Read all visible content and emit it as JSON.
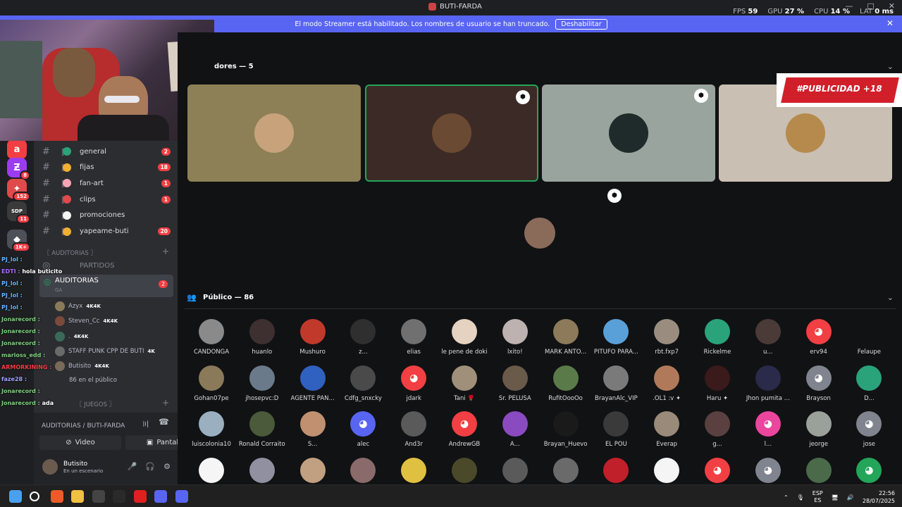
{
  "window": {
    "title": "BUTI-FARDA",
    "controls": [
      "—",
      "□",
      "✕"
    ]
  },
  "perf": {
    "fps_label": "FPS",
    "fps": "59",
    "gpu_label": "GPU",
    "gpu": "27 %",
    "cpu_label": "CPU",
    "cpu": "14 %",
    "lat_label": "LAT",
    "lat": "0 ms"
  },
  "banner": {
    "text": "El modo Streamer está habilitado. Los nombres de usuario se han truncado.",
    "button": "Deshabilitar"
  },
  "servers": [
    {
      "glyph": "a",
      "color": "#f23f43",
      "badge": ""
    },
    {
      "glyph": "Ƶ",
      "color": "#9b3cf1",
      "badge": "8"
    },
    {
      "glyph": "✦",
      "color": "#e04a4a",
      "badge": "152"
    },
    {
      "glyph": "SDP",
      "color": "#3a3a3a",
      "badge": "11"
    },
    {
      "glyph": "◆",
      "color": "#4e5058",
      "badge": "1K+"
    }
  ],
  "channels": [
    {
      "name": "general",
      "count": "2",
      "color": "#2aa37a"
    },
    {
      "name": "fijas",
      "count": "18",
      "color": "#f0b132"
    },
    {
      "name": "fan-art",
      "count": "1",
      "color": "#f7a5b5"
    },
    {
      "name": "clips",
      "count": "1",
      "color": "#e04a4a"
    },
    {
      "name": "promociones",
      "count": "",
      "color": "#f5f5f5"
    },
    {
      "name": "yapeame-buti",
      "count": "20",
      "color": "#f0b132"
    }
  ],
  "categories": {
    "auditorias": "〖 AUDITORIAS 〗",
    "juegos": "〖 JUEGOS 〗"
  },
  "partidos": "PARTIDOS",
  "stage_channel": {
    "name": "AUDITORIAS",
    "sub": "GA",
    "count": "2"
  },
  "stage_members": [
    {
      "name": "Azyx",
      "tag": "4K4K"
    },
    {
      "name": "Steven_Cc",
      "tag": "4K4K"
    },
    {
      "name": ".",
      "tag": "4K4K"
    },
    {
      "name": "STAFF PUNK CPP DE BUTI",
      "tag": "4K"
    },
    {
      "name": "Butisito",
      "tag": "4K4K"
    }
  ],
  "audience_count_label": "86 en el público",
  "chat": [
    {
      "user": "PJ_lol :",
      "msg": "",
      "color": "#6ab0ff"
    },
    {
      "user": "EDTI :",
      "msg": "hola buticito",
      "color": "#b06bff"
    },
    {
      "user": "PJ_lol :",
      "msg": "",
      "color": "#6ab0ff"
    },
    {
      "user": "PJ_lol :",
      "msg": "",
      "color": "#6ab0ff"
    },
    {
      "user": "PJ_lol :",
      "msg": "",
      "color": "#6ab0ff"
    },
    {
      "user": "Jonarecord :",
      "msg": "",
      "color": "#7ad37a"
    },
    {
      "user": "Jonarecord :",
      "msg": "",
      "color": "#7ad37a"
    },
    {
      "user": "Jonarecord :",
      "msg": "",
      "color": "#7ad37a"
    },
    {
      "user": "marioss_edd :",
      "msg": "",
      "color": "#7ad37a"
    },
    {
      "user": "ARMORKINING :",
      "msg": "",
      "color": "#f23f43"
    },
    {
      "user": "faze28 :",
      "msg": "",
      "color": "#a0a0ff"
    },
    {
      "user": "Jonarecord :",
      "msg": "",
      "color": "#7ad37a"
    },
    {
      "user": "Jonarecord :",
      "msg": "ada",
      "color": "#7ad37a"
    }
  ],
  "voice": {
    "location": "AUDITORIAS / BUTI-FARDA",
    "video": "Video",
    "screen": "Pantalla",
    "user": "Butisito",
    "user_status": "En un escenario"
  },
  "speakers_header": "dores — 5",
  "speakers": [
    {
      "color": "#8d8056",
      "avatar": "#c7a27a",
      "mod": false,
      "active": false
    },
    {
      "color": "#3c2a26",
      "avatar": "#6b4a33",
      "mod": true,
      "active": true
    },
    {
      "color": "#9aa49f",
      "avatar": "#1e2b2a",
      "mod": true,
      "active": false
    },
    {
      "color": "#c9bfb2",
      "avatar": "#b58a4c",
      "mod": false,
      "active": false
    }
  ],
  "host_avatar": "#8a6b5a",
  "promo": "#PUBLICIDAD +18",
  "audience_header": "Público — 86",
  "audience": [
    {
      "name": "CANDONGA",
      "color": "#8a8a8a"
    },
    {
      "name": "huanlo",
      "color": "#3e3030"
    },
    {
      "name": "Mushuro",
      "color": "#c0392b"
    },
    {
      "name": "z...",
      "color": "#2f2f2f"
    },
    {
      "name": "elias",
      "color": "#707070"
    },
    {
      "name": "le pene de doki",
      "color": "#e6d2c0"
    },
    {
      "name": "lxito!",
      "color": "#bdb2b0"
    },
    {
      "name": "MARK ANTO...",
      "color": "#8c7a5a"
    },
    {
      "name": "PITUFO PARA...",
      "color": "#5aa0d8"
    },
    {
      "name": "rbt.fxp7",
      "color": "#9a8d80"
    },
    {
      "name": "Rickelme",
      "color": "#2aa37a"
    },
    {
      "name": "u...",
      "color": "#4a3a38"
    },
    {
      "name": "erv94",
      "color": "#f23f43",
      "discord": true
    },
    {
      "name": "Felaupe",
      "color": "#111214"
    },
    {
      "name": "Gohan07pe",
      "color": "#8a7a5a"
    },
    {
      "name": "jhosepvc:D",
      "color": "#6a7a8a"
    },
    {
      "name": "AGENTE PAN...",
      "color": "#3060c0"
    },
    {
      "name": "Cdfg_snxcky",
      "color": "#4a4a4a"
    },
    {
      "name": "jdark",
      "color": "#f23f43",
      "discord": true
    },
    {
      "name": "Tani 🌹",
      "color": "#a0907a"
    },
    {
      "name": "Sr. PELUSA",
      "color": "#6a5a4a"
    },
    {
      "name": "RufitOooOo",
      "color": "#5a7a4a"
    },
    {
      "name": "BrayanAlc_VIP",
      "color": "#7a7a7a"
    },
    {
      "name": ".OL1 :v ✦",
      "color": "#b07a5a"
    },
    {
      "name": "Haru ✦",
      "color": "#3a1a1a"
    },
    {
      "name": "Jhon pumita ...",
      "color": "#2a2a4a"
    },
    {
      "name": "Brayson",
      "color": "#80848e",
      "discord": true
    },
    {
      "name": "D...",
      "color": "#2aa37a"
    },
    {
      "name": "luiscolonia10",
      "color": "#9ab0c0"
    },
    {
      "name": "Ronald Corraito",
      "color": "#4a5a3a"
    },
    {
      "name": "S...",
      "color": "#c09070"
    },
    {
      "name": "alec",
      "color": "#5865f2",
      "discord": true
    },
    {
      "name": "And3r",
      "color": "#5a5a5a"
    },
    {
      "name": "AndrewGB",
      "color": "#f23f43",
      "discord": true
    },
    {
      "name": "A...",
      "color": "#8a4ac0"
    },
    {
      "name": "Brayan_Huevo",
      "color": "#1a1a1a"
    },
    {
      "name": "EL POU",
      "color": "#3a3a3a"
    },
    {
      "name": "Everap",
      "color": "#9a8a7a"
    },
    {
      "name": "g...",
      "color": "#5a4040"
    },
    {
      "name": "l...",
      "color": "#eb459e",
      "discord": true
    },
    {
      "name": "jeorge",
      "color": "#9aa09a"
    },
    {
      "name": "jose",
      "color": "#80848e",
      "discord": true
    },
    {
      "name": "",
      "color": "#f5f5f5"
    },
    {
      "name": "",
      "color": "#9090a0"
    },
    {
      "name": "",
      "color": "#c0a080"
    },
    {
      "name": "",
      "color": "#8a6a6a"
    },
    {
      "name": "",
      "color": "#e0c040"
    },
    {
      "name": "",
      "color": "#4a4a2a"
    },
    {
      "name": "",
      "color": "#5a5a5a"
    },
    {
      "name": "",
      "color": "#6a6a6a"
    },
    {
      "name": "",
      "color": "#c0202a"
    },
    {
      "name": "",
      "color": "#f5f5f5"
    },
    {
      "name": "",
      "color": "#f23f43",
      "discord": true
    },
    {
      "name": "",
      "color": "#80848e",
      "discord": true
    },
    {
      "name": "",
      "color": "#4a6a4a"
    },
    {
      "name": "",
      "color": "#23a55a",
      "discord": true
    }
  ],
  "taskbar": {
    "lang1": "ESP",
    "lang2": "ES",
    "time": "22:56",
    "date": "28/07/2025"
  }
}
